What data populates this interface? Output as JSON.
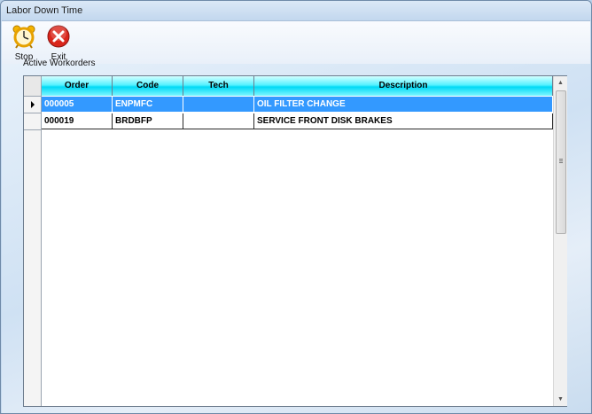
{
  "window": {
    "title": "Labor Down Time"
  },
  "toolbar": {
    "stop_label": "Stop",
    "exit_label": "Exit"
  },
  "group": {
    "label": "Active Workorders"
  },
  "grid": {
    "columns": [
      "Order",
      "Code",
      "Tech",
      "Description"
    ],
    "rows": [
      {
        "order": "000005",
        "code": "ENPMFC",
        "tech": "",
        "description": "OIL FILTER CHANGE",
        "selected": true
      },
      {
        "order": "000019",
        "code": "BRDBFP",
        "tech": "",
        "description": "SERVICE FRONT DISK BRAKES",
        "selected": false
      }
    ]
  },
  "colors": {
    "header_cyan": "#00d9f5",
    "selection_blue": "#3399ff",
    "exit_red": "#d9261c"
  },
  "icons": {
    "stop": "alarm-clock-icon",
    "exit": "close-icon",
    "current_row": "row-pointer-icon",
    "scroll_up": "scroll-up-arrow-icon",
    "scroll_down": "scroll-down-arrow-icon"
  }
}
